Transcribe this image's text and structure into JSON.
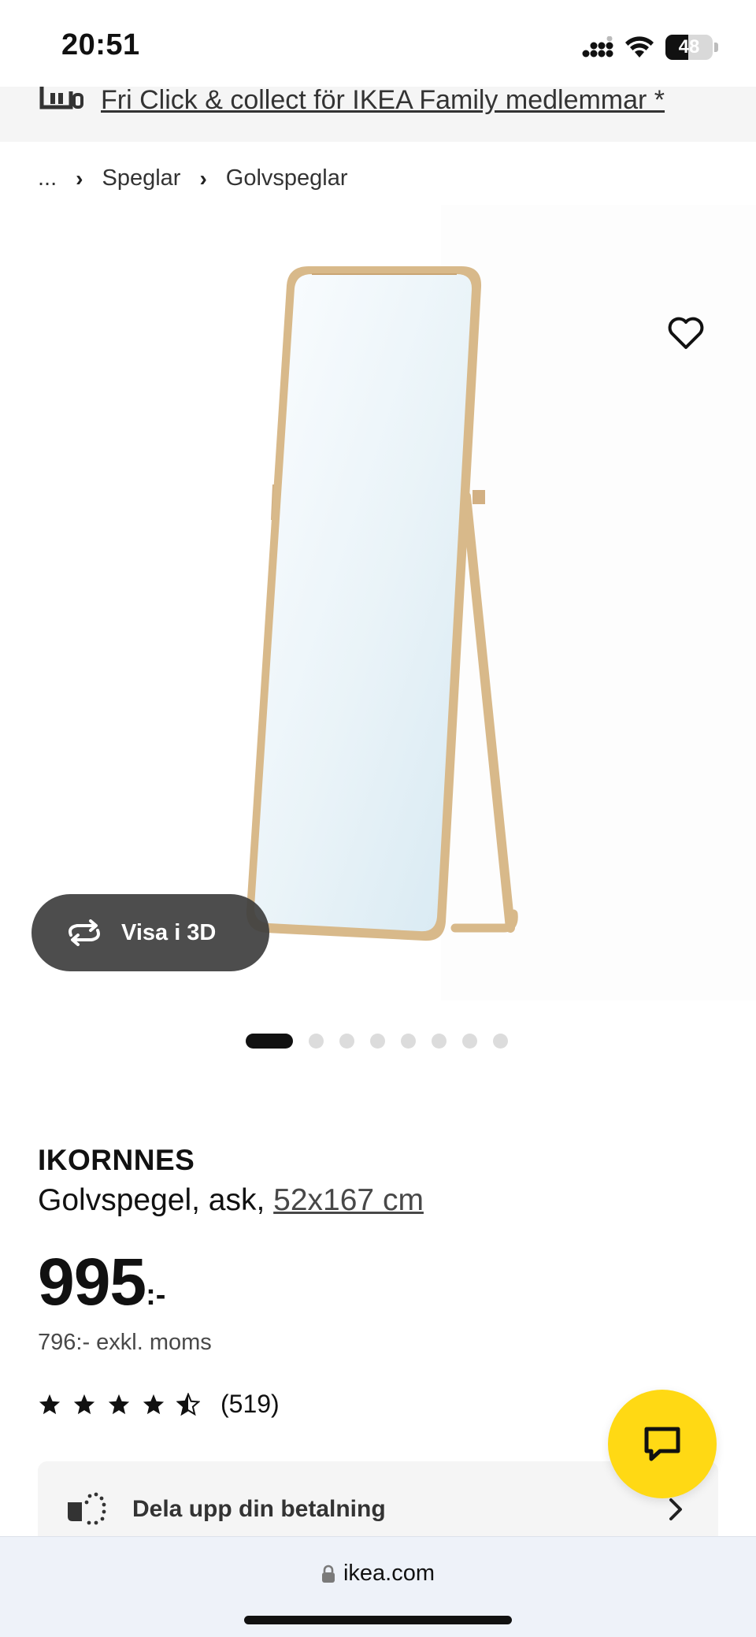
{
  "status_bar": {
    "time": "20:51",
    "battery_level": "48",
    "icons": [
      "cellular-icon",
      "wifi-icon",
      "battery-icon"
    ]
  },
  "promo": {
    "text": "Fri Click & collect för IKEA Family medlemmar *",
    "icon": "click-collect-icon"
  },
  "breadcrumb": {
    "items": [
      "...",
      "Speglar",
      "Golvspeglar"
    ]
  },
  "gallery": {
    "favorite_icon": "heart-icon",
    "view_3d_label": "Visa i 3D",
    "view_3d_icon": "rotate-3d-icon",
    "image_count": 8,
    "active_index": 0
  },
  "product": {
    "name": "IKORNNES",
    "description": "Golvspegel, ask, ",
    "size_link": "52x167 cm",
    "price": "995",
    "price_suffix": ":-",
    "price_ex_vat": "796:- exkl. moms",
    "rating": 4.5,
    "review_count": "(519)"
  },
  "payment": {
    "label": "Dela upp din betalning",
    "icon": "split-payment-icon"
  },
  "chat": {
    "icon": "chat-icon"
  },
  "browser": {
    "url": "ikea.com",
    "lock_icon": "lock-icon"
  },
  "colors": {
    "accent_yellow": "#ffd914",
    "text": "#111111",
    "banner_bg": "#f5f5f5",
    "mirror_frame": "#d8b98a"
  }
}
